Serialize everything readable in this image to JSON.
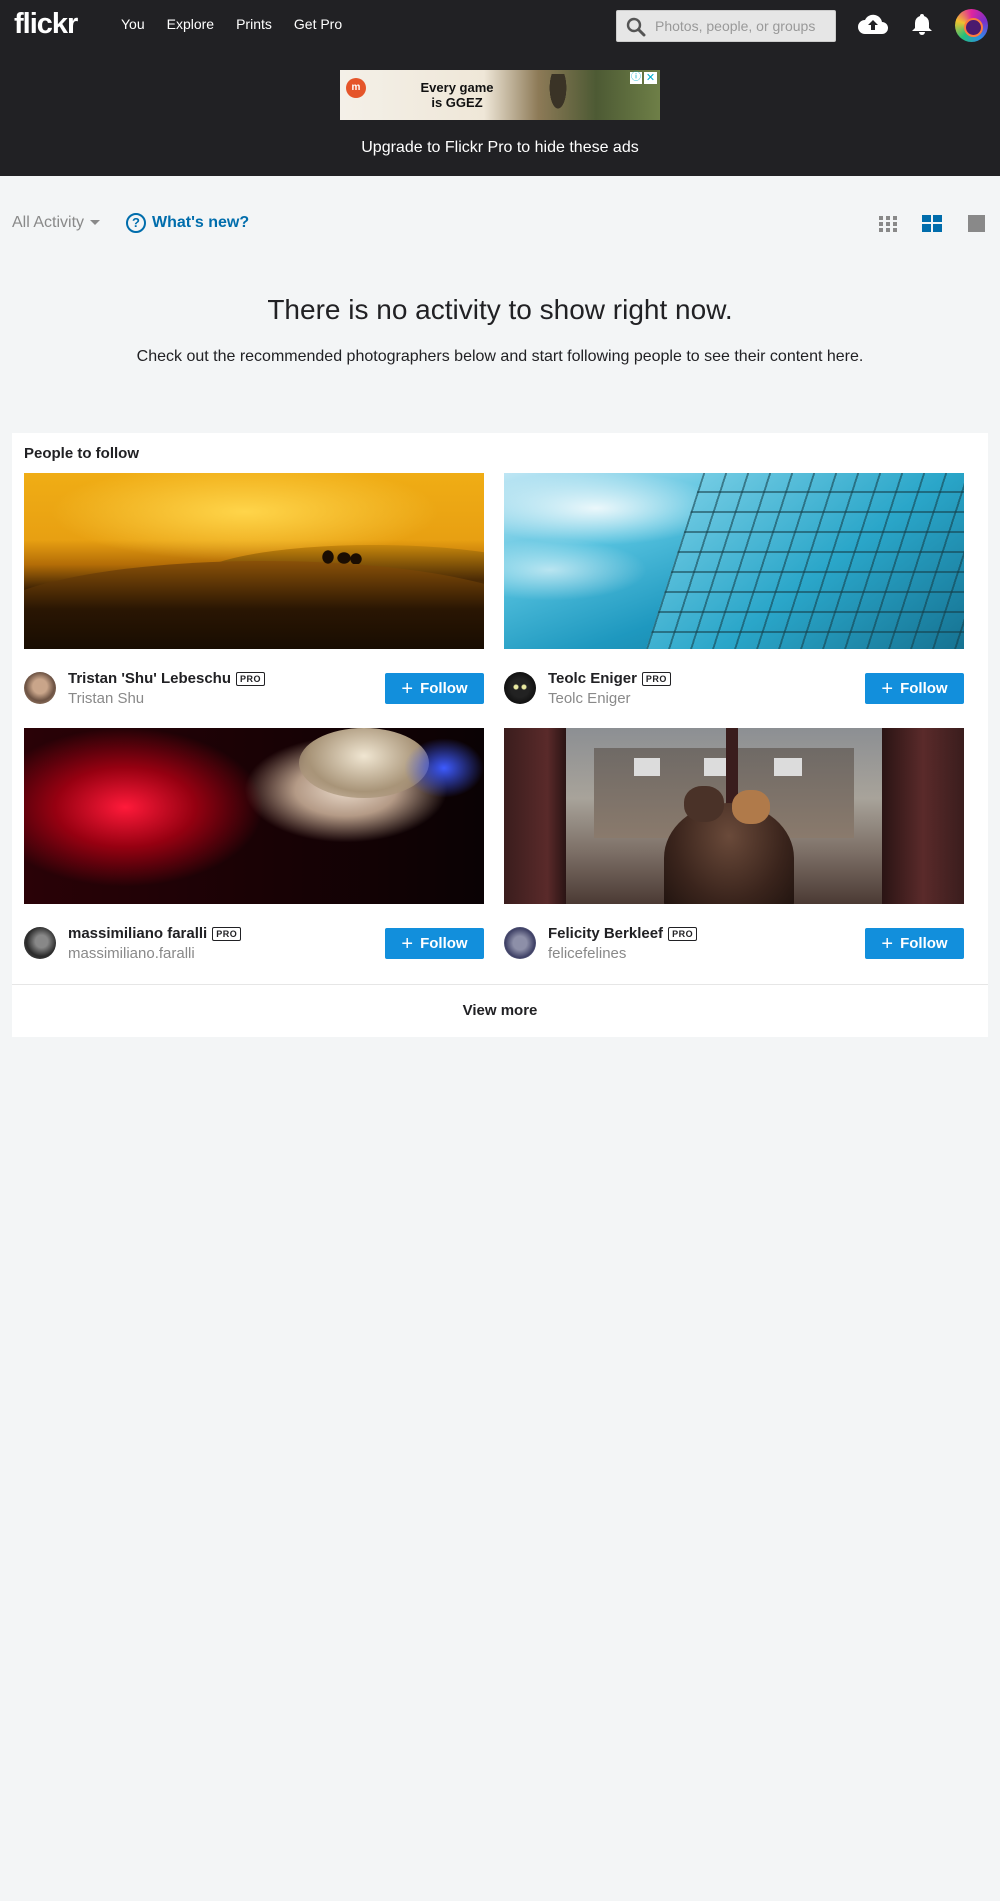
{
  "header": {
    "logo": "flickr",
    "nav": [
      "You",
      "Explore",
      "Prints",
      "Get Pro"
    ],
    "search_placeholder": "Photos, people, or groups"
  },
  "ad": {
    "logo_text": "m",
    "text_line1": "Every game",
    "text_line2": "is GGEZ",
    "info_glyph": "ⓘ",
    "close_glyph": "✕",
    "upgrade_text": "Upgrade to Flickr Pro to hide these ads"
  },
  "toolbar": {
    "filter_label": "All Activity",
    "whats_new_label": "What's new?",
    "whats_new_glyph": "?"
  },
  "empty_state": {
    "title": "There is no activity to show right now.",
    "subtitle": "Check out the recommended photographers below and start following people to see their content here."
  },
  "people": {
    "title": "People to follow",
    "pro_badge": "PRO",
    "follow_label": "Follow",
    "follow_glyph": "+",
    "view_more": "View more",
    "cards": [
      {
        "name": "Tristan 'Shu' Lebeschu",
        "username": "Tristan Shu"
      },
      {
        "name": "Teolc Eniger",
        "username": "Teolc Eniger"
      },
      {
        "name": "massimiliano faralli",
        "username": "massimiliano.faralli"
      },
      {
        "name": "Felicity Berkleef",
        "username": "felicefelines"
      }
    ]
  },
  "colors": {
    "header_bg": "#212124",
    "page_bg": "#f3f5f6",
    "follow_blue": "#128fdc",
    "link_blue": "#006dac",
    "active_view_blue": "#006dac"
  },
  "icons": [
    "search-icon",
    "upload-cloud-icon",
    "bell-icon",
    "question-icon",
    "grid-view-icon",
    "medium-view-icon",
    "large-view-icon",
    "plus-icon"
  ]
}
